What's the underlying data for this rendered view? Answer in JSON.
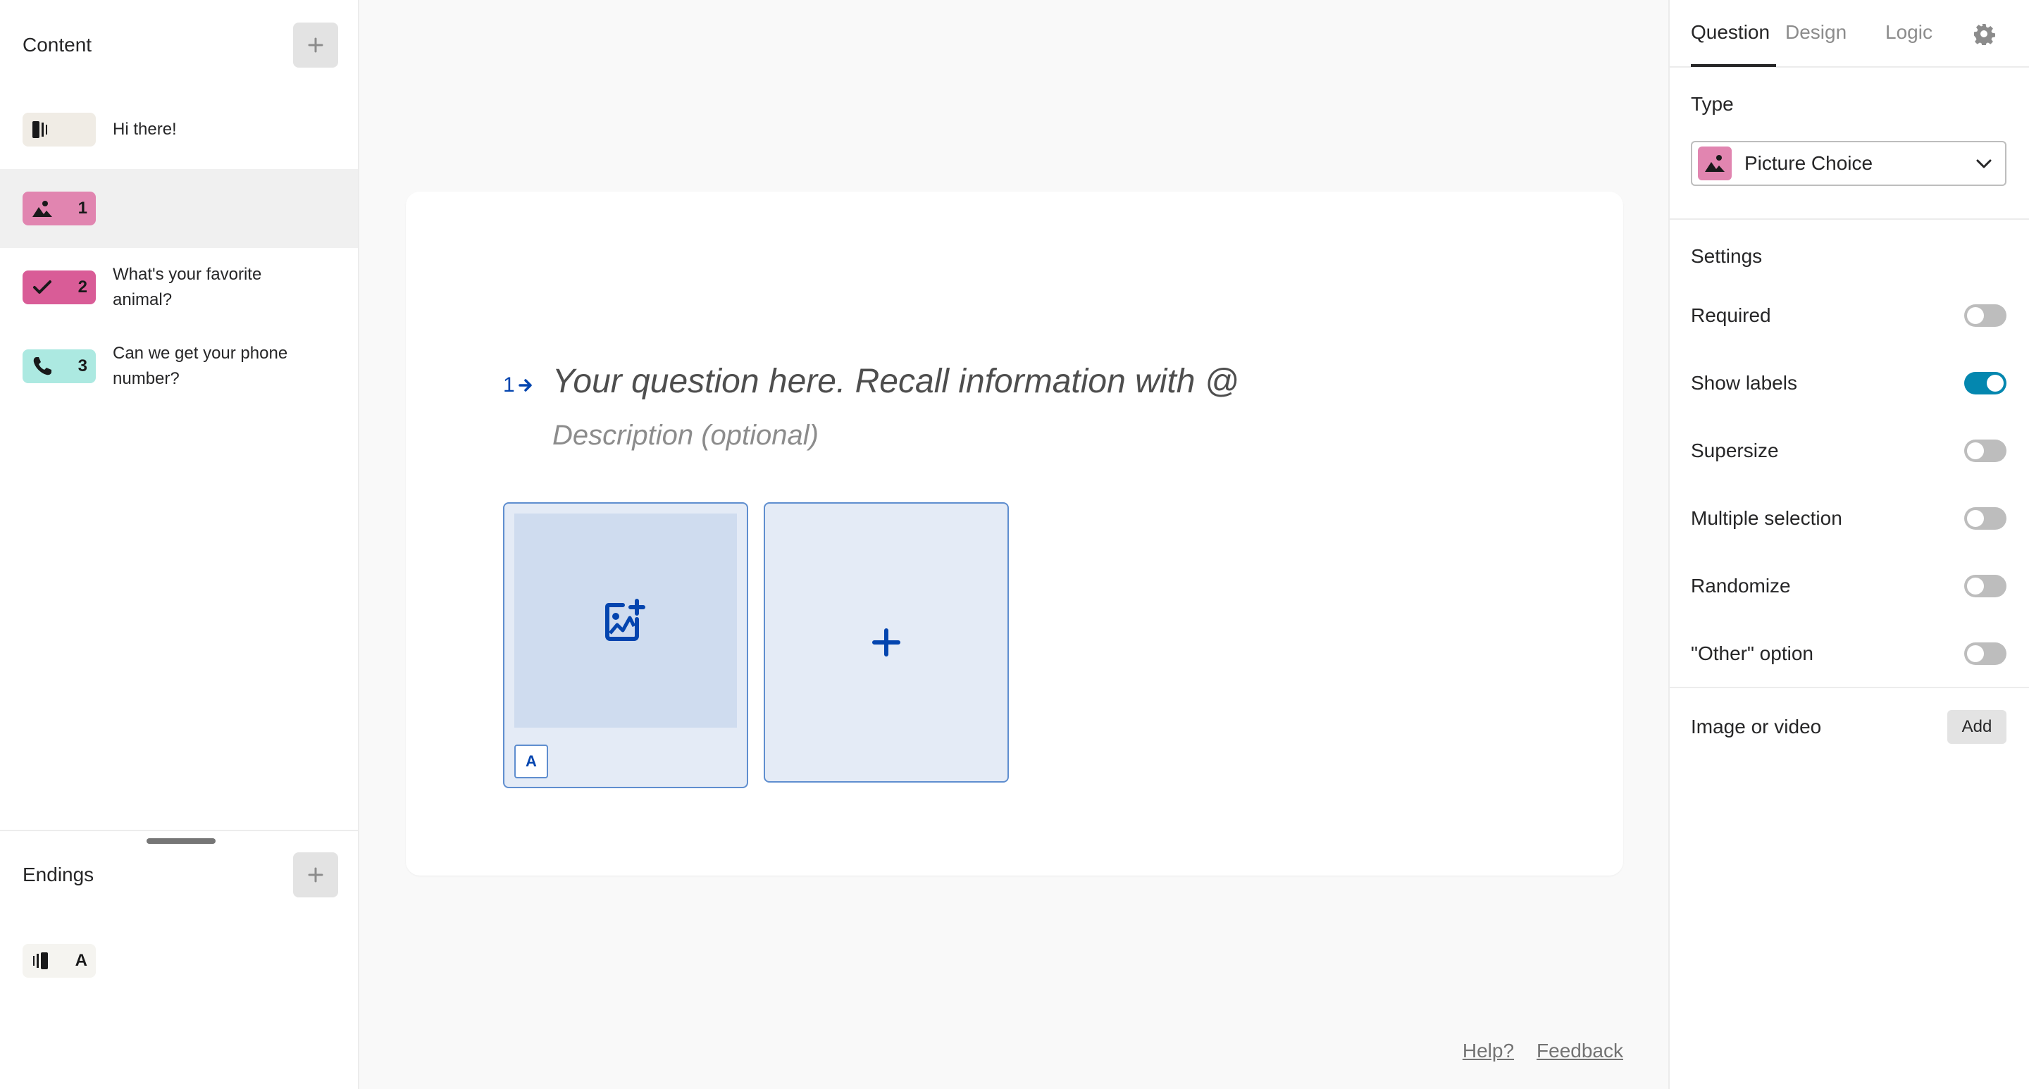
{
  "sidebar": {
    "content_title": "Content",
    "endings_title": "Endings",
    "items": [
      {
        "icon": "welcome-screen-icon",
        "number": "",
        "label": "Hi there!",
        "color": "#f0ece5",
        "selected": false
      },
      {
        "icon": "picture-icon",
        "number": "1",
        "label": "",
        "color": "#e185b0",
        "selected": true
      },
      {
        "icon": "checkmark-icon",
        "number": "2",
        "label": "What's your favorite animal?",
        "color": "#d95c97",
        "selected": false
      },
      {
        "icon": "phone-icon",
        "number": "3",
        "label": "Can we get your phone number?",
        "color": "#ace9e1",
        "selected": false
      }
    ],
    "endings": [
      {
        "icon": "ending-screen-icon",
        "number": "A",
        "color": "#f5f4f0"
      }
    ]
  },
  "canvas": {
    "question_number": "1",
    "question_placeholder": "Your question here. Recall information with @",
    "description_placeholder": "Description (optional)",
    "choices": [
      {
        "key": "A",
        "has_image": false
      }
    ],
    "accent_color": "#0445af",
    "footer": {
      "help": "Help?",
      "feedback": "Feedback"
    }
  },
  "panel": {
    "tabs": [
      {
        "label": "Question",
        "active": true
      },
      {
        "label": "Design",
        "active": false
      },
      {
        "label": "Logic",
        "active": false
      }
    ],
    "type_label": "Type",
    "type_value": "Picture Choice",
    "settings_title": "Settings",
    "settings": [
      {
        "label": "Required",
        "on": false
      },
      {
        "label": "Show labels",
        "on": true
      },
      {
        "label": "Supersize",
        "on": false
      },
      {
        "label": "Multiple selection",
        "on": false
      },
      {
        "label": "Randomize",
        "on": false
      },
      {
        "label": "\"Other\" option",
        "on": false
      }
    ],
    "media_label": "Image or video",
    "media_button": "Add",
    "toggle_on_color": "#0487af"
  }
}
